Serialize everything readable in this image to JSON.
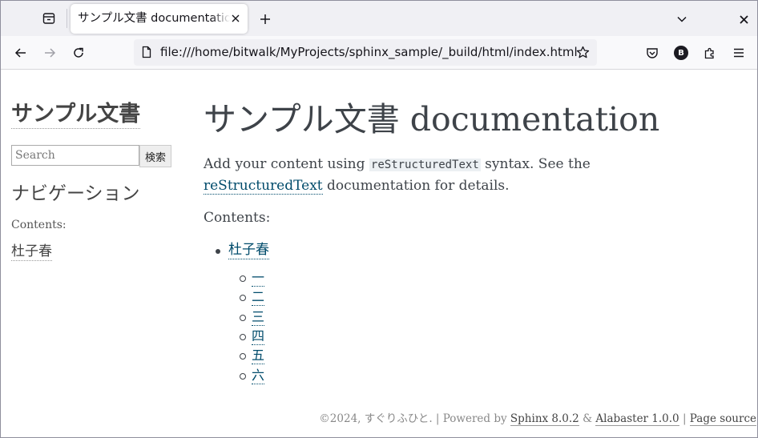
{
  "browser": {
    "tab": {
      "title": "サンプル文書 documentation"
    },
    "url": "file:///home/bitwalk/MyProjects/sphinx_sample/_build/html/index.html",
    "account_initial": "B"
  },
  "sidebar": {
    "logo_title": "サンプル文書",
    "search": {
      "placeholder": "Search",
      "button_label": "検索"
    },
    "navigation_heading": "ナビゲーション",
    "contents_caption": "Contents:",
    "links": [
      "杜子春"
    ]
  },
  "main": {
    "title": "サンプル文書 documentation",
    "intro": {
      "prefix": "Add your content using",
      "code": "reStructuredText",
      "middle": "syntax. See the",
      "link": "reStructuredText",
      "suffix": "documentation for details."
    },
    "contents_label": "Contents:",
    "toc": {
      "top": "杜子春",
      "sub": [
        "一",
        "二",
        "三",
        "四",
        "五",
        "六"
      ]
    }
  },
  "footer": {
    "copyright": "©2024, すぐりふひと.",
    "powered_by": "Powered by",
    "sphinx_link": "Sphinx 8.0.2",
    "amp": "&",
    "theme_link": "Alabaster 1.0.0",
    "page_source": "Page source"
  }
}
